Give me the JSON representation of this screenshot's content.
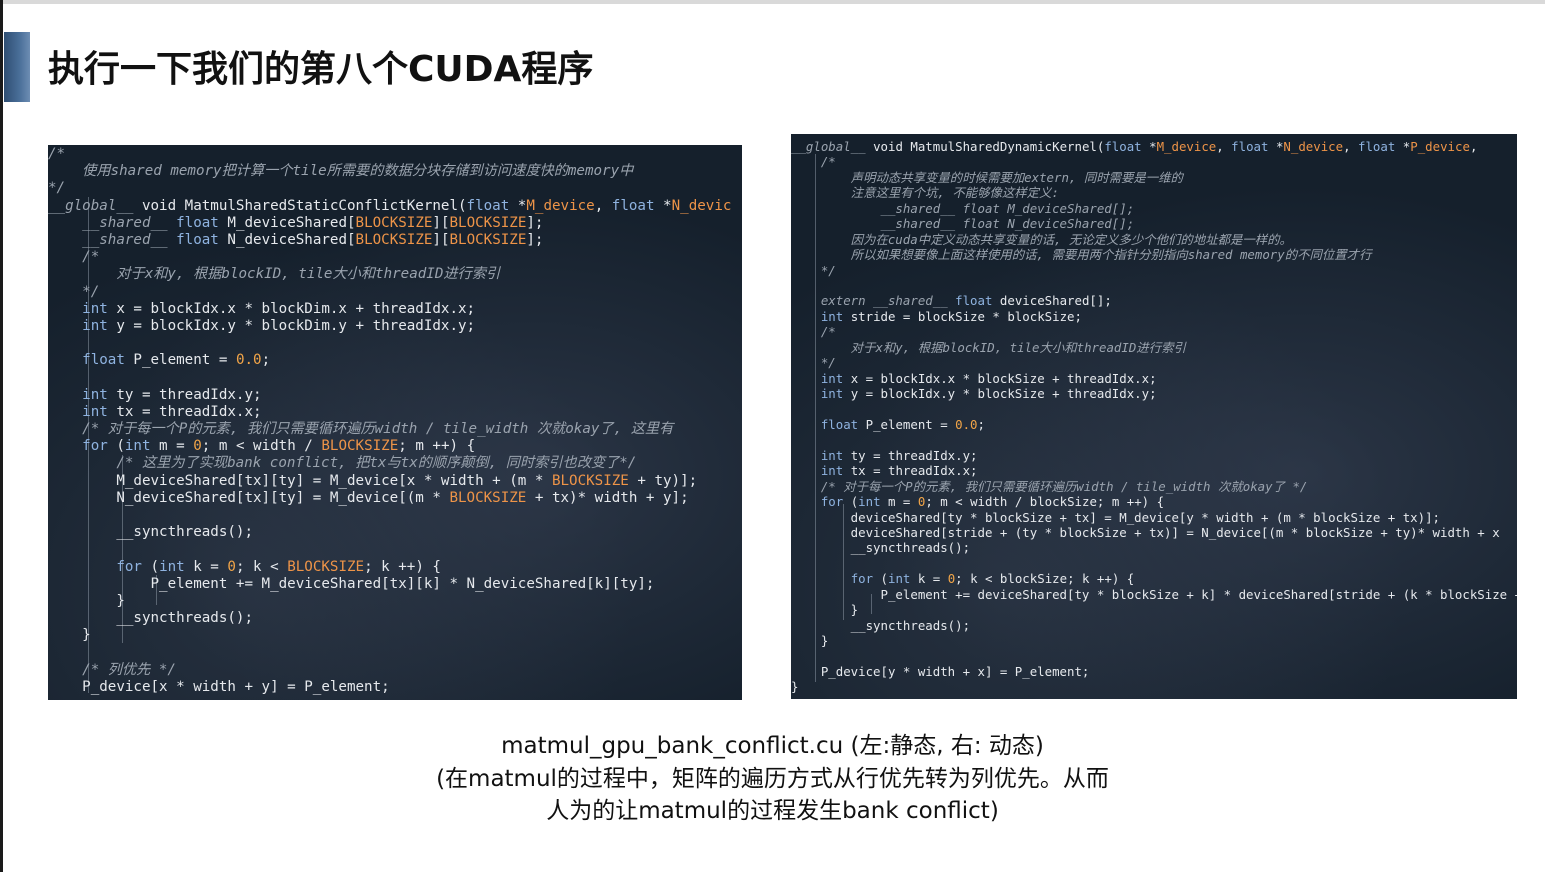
{
  "slide": {
    "title": "执行一下我们的第八个CUDA程序"
  },
  "caption": {
    "line1": "matmul_gpu_bank_conflict.cu (左:静态, 右: 动态)",
    "line2": "(在matmul的过程中，矩阵的遍历方式从行优先转为列优先。从而",
    "line3": "人为的让matmul的过程发生bank conflict)"
  },
  "colors": {
    "code_background": "#15202c",
    "keyword": "#8fb3e0",
    "number": "#f2a548",
    "macro": "#ee9448",
    "comment": "#9aa3ae",
    "title_accent": "#3d5f86",
    "pen_annotation": "#e0285a"
  },
  "code_left": {
    "lines": [
      [
        [
          "/*",
          "cm"
        ]
      ],
      [
        [
          "    使用shared memory把计算一个tile所需要的数据分块存储到访问速度快的memory中",
          "cm"
        ]
      ],
      [
        [
          "*/",
          "cm"
        ]
      ],
      [
        [
          "__global__",
          "cm"
        ],
        [
          " void MatmulSharedStaticConflictKernel(",
          "plain"
        ],
        [
          "float",
          "kw"
        ],
        [
          " *",
          "plain"
        ],
        [
          "M_device",
          "macro"
        ],
        [
          ", ",
          "plain"
        ],
        [
          "float",
          "kw"
        ],
        [
          " *",
          "plain"
        ],
        [
          "N_devic",
          "macro"
        ]
      ],
      [
        [
          "    __shared__",
          "cm"
        ],
        [
          " ",
          "plain"
        ],
        [
          "float",
          "kw"
        ],
        [
          " M_deviceShared[",
          "plain"
        ],
        [
          "BLOCKSIZE",
          "macro"
        ],
        [
          "][",
          "plain"
        ],
        [
          "BLOCKSIZE",
          "macro"
        ],
        [
          "];",
          "plain"
        ]
      ],
      [
        [
          "    __shared__",
          "cm"
        ],
        [
          " ",
          "plain"
        ],
        [
          "float",
          "kw"
        ],
        [
          " N_deviceShared[",
          "plain"
        ],
        [
          "BLOCKSIZE",
          "macro"
        ],
        [
          "][",
          "plain"
        ],
        [
          "BLOCKSIZE",
          "macro"
        ],
        [
          "];",
          "plain"
        ]
      ],
      [
        [
          "    /*",
          "cm"
        ]
      ],
      [
        [
          "        对于x和y, 根据blockID, tile大小和threadID进行索引",
          "cm"
        ]
      ],
      [
        [
          "    */",
          "cm"
        ]
      ],
      [
        [
          "    ",
          "plain"
        ],
        [
          "int",
          "kw"
        ],
        [
          " x = blockIdx.x * blockDim.x + threadIdx.x;",
          "plain"
        ]
      ],
      [
        [
          "    ",
          "plain"
        ],
        [
          "int",
          "kw"
        ],
        [
          " y = blockIdx.y * blockDim.y + threadIdx.y;",
          "plain"
        ]
      ],
      [
        [
          "",
          "plain"
        ]
      ],
      [
        [
          "    ",
          "plain"
        ],
        [
          "float",
          "kw"
        ],
        [
          " P_element = ",
          "plain"
        ],
        [
          "0.0",
          "num"
        ],
        [
          ";",
          "plain"
        ]
      ],
      [
        [
          "",
          "plain"
        ]
      ],
      [
        [
          "    ",
          "plain"
        ],
        [
          "int",
          "kw"
        ],
        [
          " ty = threadIdx.y;",
          "plain"
        ]
      ],
      [
        [
          "    ",
          "plain"
        ],
        [
          "int",
          "kw"
        ],
        [
          " tx = threadIdx.x;",
          "plain"
        ]
      ],
      [
        [
          "    /* 对于每一个P的元素, 我们只需要循环遍历width / tile_width 次就okay了, 这里有",
          "cm"
        ]
      ],
      [
        [
          "    ",
          "plain"
        ],
        [
          "for",
          "kw"
        ],
        [
          " (",
          "plain"
        ],
        [
          "int",
          "kw"
        ],
        [
          " m = ",
          "plain"
        ],
        [
          "0",
          "num"
        ],
        [
          "; m < width / ",
          "plain"
        ],
        [
          "BLOCKSIZE",
          "macro"
        ],
        [
          "; m ++) {",
          "plain"
        ]
      ],
      [
        [
          "        /* 这里为了实现bank conflict, 把tx与tx的顺序颠倒, 同时索引也改变了*/",
          "cm"
        ]
      ],
      [
        [
          "        M_deviceShared[tx][ty] = M_device[x * width + (m * ",
          "plain"
        ],
        [
          "BLOCKSIZE",
          "macro"
        ],
        [
          " + ty)];",
          "plain"
        ]
      ],
      [
        [
          "        N_deviceShared[tx][ty] = M_device[(m * ",
          "plain"
        ],
        [
          "BLOCKSIZE",
          "macro"
        ],
        [
          " + tx)* width + y];",
          "plain"
        ]
      ],
      [
        [
          "",
          "plain"
        ]
      ],
      [
        [
          "        __syncthreads();",
          "plain"
        ]
      ],
      [
        [
          "",
          "plain"
        ]
      ],
      [
        [
          "        ",
          "plain"
        ],
        [
          "for",
          "kw"
        ],
        [
          " (",
          "plain"
        ],
        [
          "int",
          "kw"
        ],
        [
          " k = ",
          "plain"
        ],
        [
          "0",
          "num"
        ],
        [
          "; k < ",
          "plain"
        ],
        [
          "BLOCKSIZE",
          "macro"
        ],
        [
          "; k ++) {",
          "plain"
        ]
      ],
      [
        [
          "            P_element += M_deviceShared[tx][k] * N_deviceShared[k][ty];",
          "plain"
        ]
      ],
      [
        [
          "        }",
          "plain"
        ]
      ],
      [
        [
          "        __syncthreads();",
          "plain"
        ]
      ],
      [
        [
          "    }",
          "plain"
        ]
      ],
      [
        [
          "",
          "plain"
        ]
      ],
      [
        [
          "    /* 列优先 */",
          "cm"
        ]
      ],
      [
        [
          "    P_device[x * width + y] = P_element;",
          "plain"
        ]
      ]
    ]
  },
  "code_right": {
    "lines": [
      [
        [
          "__global__",
          "cm"
        ],
        [
          " void MatmulSharedDynamicKernel(",
          "plain"
        ],
        [
          "float",
          "kw"
        ],
        [
          " *",
          "plain"
        ],
        [
          "M_device",
          "macro"
        ],
        [
          ", ",
          "plain"
        ],
        [
          "float",
          "kw"
        ],
        [
          " *",
          "plain"
        ],
        [
          "N_device",
          "macro"
        ],
        [
          ", ",
          "plain"
        ],
        [
          "float",
          "kw"
        ],
        [
          " *",
          "plain"
        ],
        [
          "P_device",
          "macro"
        ],
        [
          ",",
          "plain"
        ]
      ],
      [
        [
          "    /*",
          "cm"
        ]
      ],
      [
        [
          "        声明动态共享变量的时候需要加extern, 同时需要是一维的",
          "cm"
        ]
      ],
      [
        [
          "        注意这里有个坑, 不能够像这样定义:",
          "cm"
        ]
      ],
      [
        [
          "            __shared__ float M_deviceShared[];",
          "cm"
        ]
      ],
      [
        [
          "            __shared__ float N_deviceShared[];",
          "cm"
        ]
      ],
      [
        [
          "        因为在cuda中定义动态共享变量的话, 无论定义多少个他们的地址都是一样的。",
          "cm"
        ]
      ],
      [
        [
          "        所以如果想要像上面这样使用的话, 需要用两个指针分别指向shared memory的不同位置才行",
          "cm"
        ]
      ],
      [
        [
          "    */",
          "cm"
        ]
      ],
      [
        [
          "",
          "plain"
        ]
      ],
      [
        [
          "    extern __shared__",
          "cm"
        ],
        [
          " ",
          "plain"
        ],
        [
          "float",
          "kw"
        ],
        [
          " deviceShared[];",
          "plain"
        ]
      ],
      [
        [
          "    ",
          "plain"
        ],
        [
          "int",
          "kw"
        ],
        [
          " stride = blockSize * blockSize;",
          "plain"
        ]
      ],
      [
        [
          "    /*",
          "cm"
        ]
      ],
      [
        [
          "        对于x和y, 根据blockID, tile大小和threadID进行索引",
          "cm"
        ]
      ],
      [
        [
          "    */",
          "cm"
        ]
      ],
      [
        [
          "    ",
          "plain"
        ],
        [
          "int",
          "kw"
        ],
        [
          " x = blockIdx.x * blockSize + threadIdx.x;",
          "plain"
        ]
      ],
      [
        [
          "    ",
          "plain"
        ],
        [
          "int",
          "kw"
        ],
        [
          " y = blockIdx.y * blockSize + threadIdx.y;",
          "plain"
        ]
      ],
      [
        [
          "",
          "plain"
        ]
      ],
      [
        [
          "    ",
          "plain"
        ],
        [
          "float",
          "kw"
        ],
        [
          " P_element = ",
          "plain"
        ],
        [
          "0.0",
          "num"
        ],
        [
          ";",
          "plain"
        ]
      ],
      [
        [
          "",
          "plain"
        ]
      ],
      [
        [
          "    ",
          "plain"
        ],
        [
          "int",
          "kw"
        ],
        [
          " ty = threadIdx.y;",
          "plain"
        ]
      ],
      [
        [
          "    ",
          "plain"
        ],
        [
          "int",
          "kw"
        ],
        [
          " tx = threadIdx.x;",
          "plain"
        ]
      ],
      [
        [
          "    /* 对于每一个P的元素, 我们只需要循环遍历width / tile_width 次就okay了 */",
          "cm"
        ]
      ],
      [
        [
          "    ",
          "plain"
        ],
        [
          "for",
          "kw"
        ],
        [
          " (",
          "plain"
        ],
        [
          "int",
          "kw"
        ],
        [
          " m = ",
          "plain"
        ],
        [
          "0",
          "num"
        ],
        [
          "; m < width / blockSize; m ++) {",
          "plain"
        ]
      ],
      [
        [
          "        deviceShared[ty * blockSize + tx] = M_device[y * width + (m * blockSize + tx)];",
          "plain"
        ]
      ],
      [
        [
          "        deviceShared[stride + (ty * blockSize + tx)] = N_device[(m * blockSize + ty)* width + x",
          "plain"
        ]
      ],
      [
        [
          "        __syncthreads();",
          "plain"
        ]
      ],
      [
        [
          "",
          "plain"
        ]
      ],
      [
        [
          "        ",
          "plain"
        ],
        [
          "for",
          "kw"
        ],
        [
          " (",
          "plain"
        ],
        [
          "int",
          "kw"
        ],
        [
          " k = ",
          "plain"
        ],
        [
          "0",
          "num"
        ],
        [
          "; k < blockSize; k ++) {",
          "plain"
        ]
      ],
      [
        [
          "            P_element += deviceShared[ty * blockSize + k] * deviceShared[stride + (k * blockSize + tx)];",
          "plain"
        ]
      ],
      [
        [
          "        }",
          "plain"
        ]
      ],
      [
        [
          "        __syncthreads();",
          "plain"
        ]
      ],
      [
        [
          "    }",
          "plain"
        ]
      ],
      [
        [
          "",
          "plain"
        ]
      ],
      [
        [
          "    P_device[y * width + x] = P_element;",
          "plain"
        ]
      ],
      [
        [
          "}",
          "plain"
        ]
      ]
    ]
  }
}
